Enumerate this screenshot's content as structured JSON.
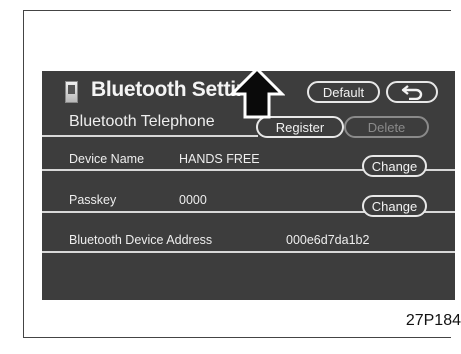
{
  "screen": {
    "title": "Bluetooth Settings",
    "buttons": {
      "default_label": "Default",
      "register_label": "Register",
      "delete_label": "Delete",
      "change_label": "Change"
    },
    "rows": {
      "telephone_label": "Bluetooth Telephone",
      "device_name_label": "Device Name",
      "device_name_value": "HANDS FREE",
      "passkey_label": "Passkey",
      "passkey_value": "0000",
      "address_label": "Bluetooth Device Address",
      "address_value": "000e6d7da1b2"
    }
  },
  "figure_code": "27P184",
  "icons": [
    "phone-icon",
    "back-arrow-icon",
    "pointer-arrow-icon"
  ],
  "colors": {
    "screen_bg": "#3d3d3d",
    "text": "#eeeeee",
    "border": "#e8e8e8",
    "disabled": "#8a8a8a"
  }
}
